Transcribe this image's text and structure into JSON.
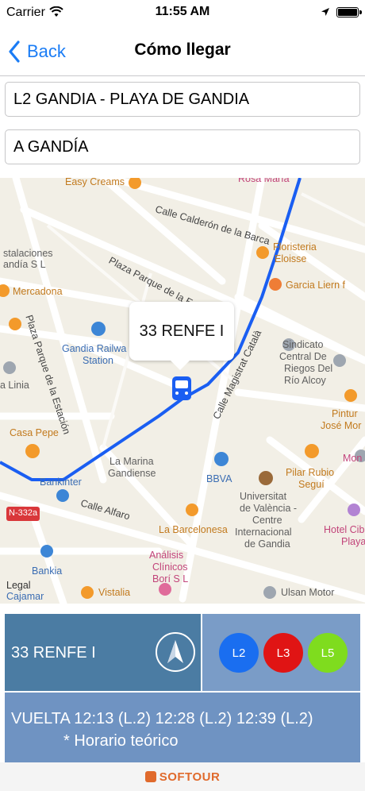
{
  "status_bar": {
    "carrier": "Carrier",
    "time": "11:55 AM"
  },
  "nav": {
    "back_label": "Back",
    "title": "Cómo llegar"
  },
  "fields": {
    "line": "L2 GANDIA - PLAYA DE GANDIA",
    "direction": "A GANDÍA"
  },
  "map": {
    "callout": "33 RENFE I",
    "labels": {
      "easy_creams": "Easy Creams",
      "rosa_maria": "Rosa María",
      "calle_calderon": "Calle Calderón de la Barca",
      "estalaciones": "stalaciones",
      "gandia_sl": "andía S L",
      "plaza_parque_top": "Plaza Parque de la Estación",
      "floristeria": "Floristeria",
      "eloisse": "Eloisse",
      "garcia_liern": "Garcia Liern f",
      "mercadona": "Mercadona",
      "plaza_parque_side": "Plaza Parque de la Estación",
      "gandia_railway": "Gandia Railwa",
      "station": "Station",
      "sindicato1": "Sindicato",
      "sindicato2": "Central De",
      "sindicato3": "Riegos Del",
      "sindicato4": "Río Alcoy",
      "linia": "a Linia",
      "pintura": "Pintur",
      "jose_mor": "José Mor",
      "casa_pepe": "Casa Pepe",
      "calle_magistrat": "Calle Magistrat Català",
      "marina1": "La Marina",
      "marina2": "Gandiense",
      "mon": "Mon",
      "bbva": "BBVA",
      "pilar1": "Pilar Rubio",
      "pilar2": "Seguí",
      "bankinter": "Bankinter",
      "n332a": "N-332a",
      "calle_alfaro": "Calle Alfaro",
      "univ1": "Universitat",
      "univ2": "de València -",
      "univ3": "Centre",
      "univ4": "Internacional",
      "univ5": "de Gandia",
      "hotel1": "Hotel Cib",
      "hotel2": "Playa",
      "barcelonesa": "La Barcelonesa",
      "analisis1": "Análisis",
      "analisis2": "Clínicos",
      "analisis3": "Borí S L",
      "bankia": "Bankia",
      "legal": "Legal",
      "cajamar": "Cajamar",
      "vistalia": "Vistalia",
      "ulsan": "Ulsan Motor"
    }
  },
  "panel": {
    "stop_name": "33 RENFE I",
    "lines": [
      {
        "label": "L2",
        "color": "#1a6ef0"
      },
      {
        "label": "L3",
        "color": "#e01414"
      },
      {
        "label": "L5",
        "color": "#7fdc1e"
      }
    ],
    "schedule": "VUELTA 12:13 (L.2) 12:28 (L.2) 12:39 (L.2)",
    "note": "* Horario teórico"
  },
  "footer": {
    "brand": "SOFTOUR"
  },
  "colors": {
    "ios_blue": "#1a7cf5",
    "stop_box": "#4b7ca3",
    "lines_box": "#7a9cc7",
    "sched_box": "#6f93c2",
    "route": "#1a5ef2"
  }
}
